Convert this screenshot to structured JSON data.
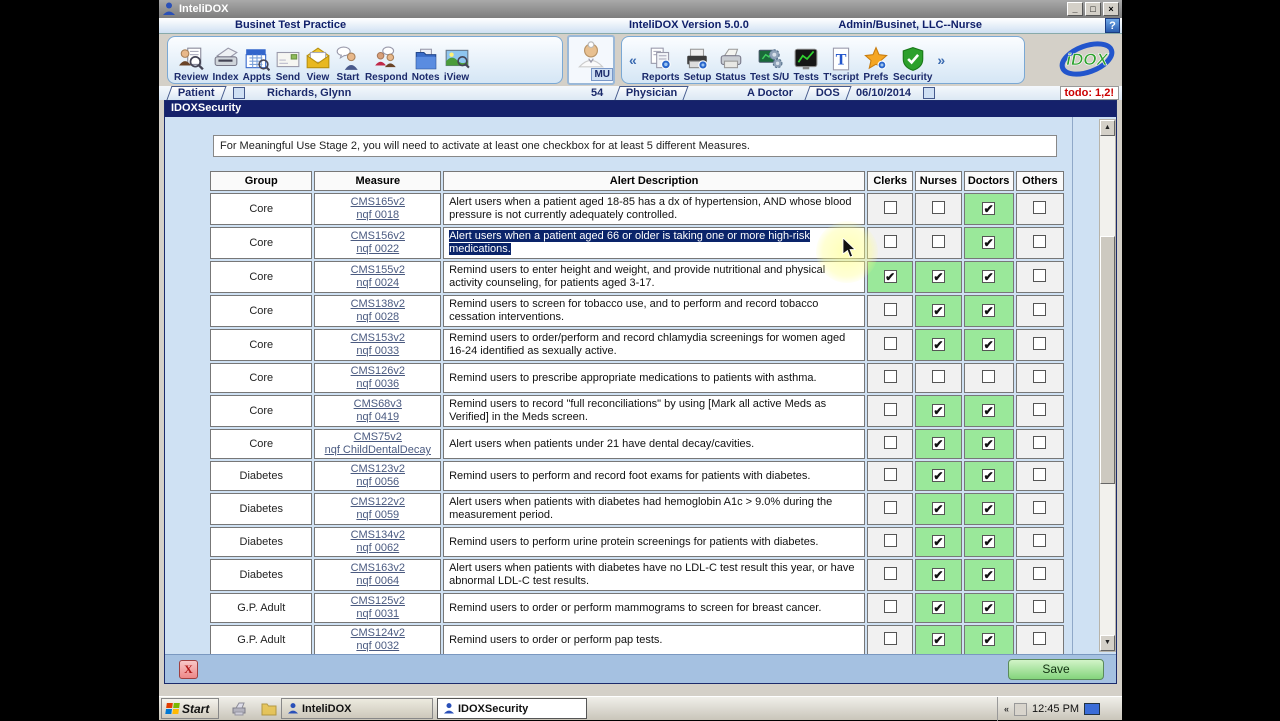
{
  "app": {
    "title": "InteliDOX",
    "practice": "Businet Test Practice",
    "version": "InteliDOX Version 5.0.0",
    "user": "Admin/Businet, LLC--Nurse",
    "help": "?",
    "minimize": "_",
    "restore": "□",
    "close": "×"
  },
  "toolbar": {
    "left": [
      "Review",
      "Index",
      "Appts",
      "Send",
      "View",
      "Start",
      "Respond",
      "Notes",
      "iView"
    ],
    "mu": "MU",
    "chevron_left": "«",
    "chevron_right": "»",
    "right": [
      "Reports",
      "Setup",
      "Status",
      "Test S/U",
      "Tests",
      "T'script",
      "Prefs",
      "Security"
    ],
    "logo": "iDOX"
  },
  "patient_bar": {
    "patient_label": "Patient",
    "patient_name": "Richards, Glynn",
    "age": "54",
    "physician_label": "Physician",
    "physician_name": "A Doctor",
    "dos_label": "DOS",
    "dos_date": "06/10/2014",
    "todo": "todo: 1,2!"
  },
  "dialog": {
    "title": "IDOXSecurity",
    "notice": "For Meaningful Use Stage 2, you will need to activate at least one checkbox for at least 5 different Measures.",
    "close": "X",
    "save": "Save"
  },
  "table": {
    "headers": [
      "Group",
      "Measure",
      "Alert Description",
      "Clerks",
      "Nurses",
      "Doctors",
      "Others"
    ],
    "check_columns": [
      "clerks",
      "nurses",
      "doctors",
      "others"
    ],
    "rows": [
      {
        "group": "Core",
        "cms": "CMS165v2",
        "nqf": "nqf 0018",
        "description": "Alert users when a patient aged 18-85 has a dx of hypertension, AND whose blood pressure is not currently adequately controlled.",
        "checks": [
          false,
          false,
          true,
          false
        ],
        "selected": false
      },
      {
        "group": "Core",
        "cms": "CMS156v2",
        "nqf": "nqf 0022",
        "description": "Alert users when a patient aged 66 or older is taking one or more high-risk medications.",
        "checks": [
          false,
          false,
          true,
          false
        ],
        "selected": true
      },
      {
        "group": "Core",
        "cms": "CMS155v2",
        "nqf": "nqf 0024",
        "description": "Remind users to enter height and weight, and provide nutritional and physical activity counseling, for patients aged 3-17.",
        "checks": [
          true,
          true,
          true,
          false
        ],
        "selected": false
      },
      {
        "group": "Core",
        "cms": "CMS138v2",
        "nqf": "nqf 0028",
        "description": "Remind users to screen for tobacco use, and to perform and record tobacco cessation interventions.",
        "checks": [
          false,
          true,
          true,
          false
        ],
        "selected": false
      },
      {
        "group": "Core",
        "cms": "CMS153v2",
        "nqf": "nqf 0033",
        "description": "Remind users to order/perform and record chlamydia screenings for women aged 16-24 identified as sexually active.",
        "checks": [
          false,
          true,
          true,
          false
        ],
        "selected": false
      },
      {
        "group": "Core",
        "cms": "CMS126v2",
        "nqf": "nqf 0036",
        "description": "Remind users to prescribe appropriate medications to patients with asthma.",
        "checks": [
          false,
          false,
          false,
          false
        ],
        "selected": false
      },
      {
        "group": "Core",
        "cms": "CMS68v3",
        "nqf": "nqf 0419",
        "description": "Remind users to record \"full reconciliations\" by using [Mark all active Meds as Verified] in the Meds screen.",
        "checks": [
          false,
          true,
          true,
          false
        ],
        "selected": false
      },
      {
        "group": "Core",
        "cms": "CMS75v2",
        "nqf": "nqf ChildDentalDecay",
        "description": "Alert users when patients under 21 have dental decay/cavities.",
        "checks": [
          false,
          true,
          true,
          false
        ],
        "selected": false
      },
      {
        "group": "Diabetes",
        "cms": "CMS123v2",
        "nqf": "nqf 0056",
        "description": "Remind users to perform and record foot exams for patients with diabetes.",
        "checks": [
          false,
          true,
          true,
          false
        ],
        "selected": false
      },
      {
        "group": "Diabetes",
        "cms": "CMS122v2",
        "nqf": "nqf 0059",
        "description": "Alert users when patients with diabetes had hemoglobin A1c > 9.0% during the measurement period.",
        "checks": [
          false,
          true,
          true,
          false
        ],
        "selected": false
      },
      {
        "group": "Diabetes",
        "cms": "CMS134v2",
        "nqf": "nqf 0062",
        "description": "Remind users to perform urine protein screenings for patients with diabetes.",
        "checks": [
          false,
          true,
          true,
          false
        ],
        "selected": false
      },
      {
        "group": "Diabetes",
        "cms": "CMS163v2",
        "nqf": "nqf 0064",
        "description": "Alert users when patients with diabetes have no LDL-C test result this year, or have abnormal LDL-C test results.",
        "checks": [
          false,
          true,
          true,
          false
        ],
        "selected": false
      },
      {
        "group": "G.P. Adult",
        "cms": "CMS125v2",
        "nqf": "nqf 0031",
        "description": "Remind users to order or perform mammograms to screen for breast cancer.",
        "checks": [
          false,
          true,
          true,
          false
        ],
        "selected": false
      },
      {
        "group": "G.P. Adult",
        "cms": "CMS124v2",
        "nqf": "nqf 0032",
        "description": "Remind users to order or perform pap tests.",
        "checks": [
          false,
          true,
          true,
          false
        ],
        "selected": false
      }
    ]
  },
  "taskbar": {
    "start": "Start",
    "buttons": [
      "InteliDOX",
      "IDOXSecurity"
    ],
    "time": "12:45 PM"
  },
  "colors": {
    "checked_cell": "#9ae89a",
    "selection": "#0a246a",
    "accent_navy": "#1b2a6b",
    "save_green": "#84d47c",
    "dialog_title": "#15216b"
  }
}
